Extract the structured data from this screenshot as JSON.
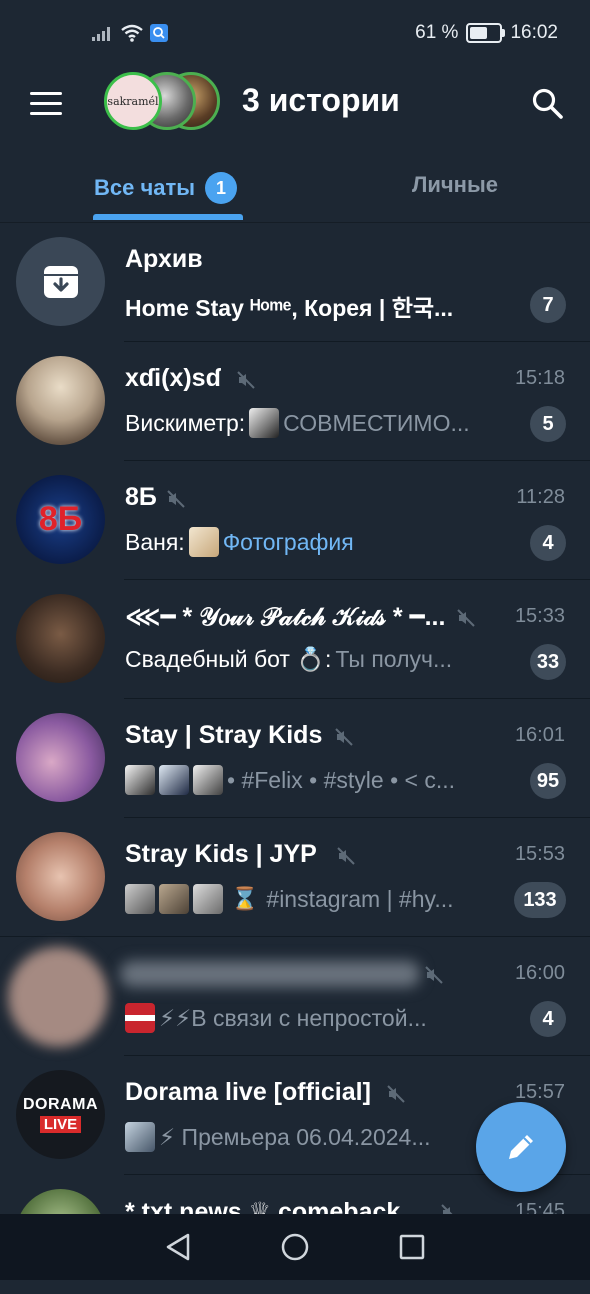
{
  "status_bar": {
    "battery_percent": "61 %",
    "battery_level": 0.61,
    "time": "16:02"
  },
  "header": {
    "title": "3 истории",
    "story_avatar_text": "sakramél"
  },
  "tabs": [
    {
      "label": "Все чаты",
      "badge": "1",
      "active": true
    },
    {
      "label": "Личные",
      "active": false
    }
  ],
  "chats": [
    {
      "name": "Архив",
      "time": "",
      "sender": "",
      "preview": "Home Stay ᴴᵒᵐᵉ, Корея | 한국...",
      "count": "7",
      "muted": false
    },
    {
      "name": "xɗi(x)sɗ",
      "time": "15:18",
      "sender": "Вискиметр:",
      "preview": "СОВМЕСТИМО...",
      "count": "5",
      "muted": true
    },
    {
      "name": "8Б",
      "time": "11:28",
      "sender": "Ваня:",
      "preview": "Фотография",
      "count": "4",
      "muted": true,
      "avatar_text": "8Б"
    },
    {
      "name": "⋘━ * 𝒴𝑜𝓊𝓇 𝒫𝒶𝓉𝒸𝒽 𝒦𝒾𝒹𝓈 * ━...",
      "time": "15:33",
      "sender": "Свадебный бот 💍:",
      "preview": "Ты получ...",
      "count": "33",
      "muted": true
    },
    {
      "name": "Stay | Stray Kids",
      "time": "16:01",
      "sender": "",
      "preview": "• #Felix • #style •   < c...",
      "count": "95",
      "muted": true
    },
    {
      "name": "Stray Kids | JYP",
      "time": "15:53",
      "sender": "",
      "preview": "#instagram | #hy...",
      "count": "133",
      "muted": true
    },
    {
      "name": "",
      "time": "16:00",
      "sender": "",
      "preview": "⚡⚡В связи с непростой...",
      "count": "4",
      "muted": true
    },
    {
      "name": "Dorama live [official]",
      "time": "15:57",
      "sender": "",
      "preview": "⚡ Премьера 06.04.2024...",
      "count": "",
      "muted": true,
      "avatar_text_1": "DORAMA",
      "avatar_text_2": "LIVE"
    },
    {
      "name": "* txt news ♕ comeback",
      "time": "15:45",
      "sender": "",
      "preview": "",
      "count": "",
      "muted": true
    }
  ],
  "icons": {
    "menu": "hamburger-icon",
    "search": "search-icon",
    "archive": "archive-icon",
    "mute": "muted-speaker-icon",
    "fab": "pencil-icon",
    "nav": [
      "back-icon",
      "home-icon",
      "recents-icon"
    ]
  },
  "colors": {
    "background": "#1d2733",
    "accent": "#4aa3f0",
    "badge_muted": "#3e4b59",
    "fab": "#5aa5e8"
  }
}
